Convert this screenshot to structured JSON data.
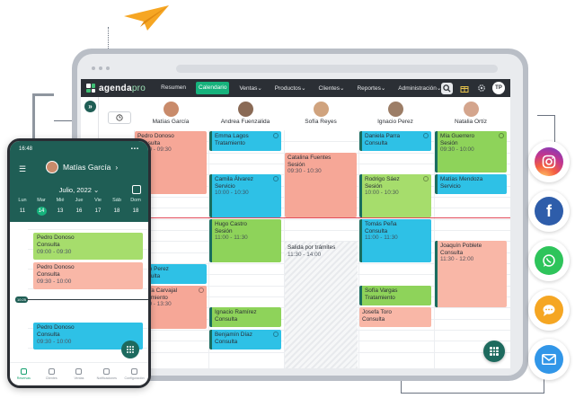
{
  "navbar": {
    "logo_text": "agenda",
    "logo_suffix": "pro",
    "menu": [
      {
        "label": "Resumen",
        "active": false
      },
      {
        "label": "Calendario",
        "active": true
      },
      {
        "label": "Ventas",
        "active": false
      },
      {
        "label": "Productos",
        "active": false
      },
      {
        "label": "Clientes",
        "active": false
      },
      {
        "label": "Reportes",
        "active": false
      },
      {
        "label": "Administración",
        "active": false
      }
    ],
    "user_initials": "TP"
  },
  "professionals": [
    {
      "name": "Matías García",
      "color": "#c98b6b"
    },
    {
      "name": "Andrea Fuenzalida",
      "color": "#8a6a55"
    },
    {
      "name": "Sofía Reyes",
      "color": "#d0a37e"
    },
    {
      "name": "Ignacio Perez",
      "color": "#9c7d66"
    },
    {
      "name": "Natalia Ortíz",
      "color": "#d4a58d"
    }
  ],
  "appointments": [
    {
      "name": "Pedro Donoso",
      "service": "Consulta",
      "time": "09:30 - 09:30"
    },
    {
      "name": "Emma Lagos",
      "service": "Tratamiento",
      "time": ""
    },
    {
      "name": "Daniela Parra",
      "service": "Consulta",
      "time": ""
    },
    {
      "name": "Mía Guerrero",
      "service": "Sesión",
      "time": "09:30 - 10:00"
    },
    {
      "name": "Catalina Fuentes",
      "service": "Sesión",
      "time": "09:30 - 10:30"
    },
    {
      "name": "Camila Álvarez",
      "service": "Servicio",
      "time": "10:00 - 10:30"
    },
    {
      "name": "Rodrigo Sáez",
      "service": "Sesión",
      "time": "10:00 - 10:30"
    },
    {
      "name": "Matías Mendoza",
      "service": "Servicio",
      "time": ""
    },
    {
      "name": "Hugo Castro",
      "service": "Sesión",
      "time": "11:00 - 11:30"
    },
    {
      "name": "Tomás Peña",
      "service": "Consulta",
      "time": "11:00 - 11:30"
    },
    {
      "name": "Salida por trámites",
      "service": "11:30 - 14:00",
      "time": ""
    },
    {
      "name": "Joaquín Poblete",
      "service": "Consulta",
      "time": "11:30 - 12:00"
    },
    {
      "name": "Pablo Perez",
      "service": "Consulta",
      "time": ""
    },
    {
      "name": "Josefa Carvajal",
      "service": "Tratamiento",
      "time": "12:30 - 13:30"
    },
    {
      "name": "Sofía Vargas",
      "service": "Tratamiento",
      "time": ""
    },
    {
      "name": "Ignacio Ramírez",
      "service": "Consulta",
      "time": ""
    },
    {
      "name": "Josefa Toro",
      "service": "Consulta",
      "time": ""
    },
    {
      "name": "Benjamín Díaz",
      "service": "Consulta",
      "time": ""
    }
  ],
  "phone": {
    "status_time": "16:48",
    "user_name": "Matías García",
    "month": "Julio, 2022",
    "days": [
      {
        "dow": "Lun",
        "num": "11",
        "selected": false
      },
      {
        "dow": "Mar",
        "num": "14",
        "selected": true
      },
      {
        "dow": "Mié",
        "num": "13",
        "selected": false
      },
      {
        "dow": "Jue",
        "num": "16",
        "selected": false
      },
      {
        "dow": "Vie",
        "num": "17",
        "selected": false
      },
      {
        "dow": "Sáb",
        "num": "18",
        "selected": false
      },
      {
        "dow": "Dom",
        "num": "18",
        "selected": false
      }
    ],
    "now_tag": "10:25",
    "appointments": [
      {
        "name": "Pedro Donoso",
        "service": "Consulta",
        "time": "09:00 - 09:30"
      },
      {
        "name": "Pedro Donoso",
        "service": "Consulta",
        "time": "09:30 - 10:00"
      },
      {
        "name": "Pedro Donoso",
        "service": "Consulta",
        "time": "09:30 - 10:00"
      }
    ],
    "tabs": [
      "Reservas",
      "Clientes",
      "Ventas",
      "Notificaciones",
      "Configuración"
    ]
  },
  "channels": [
    "instagram-icon",
    "facebook-icon",
    "whatsapp-icon",
    "sms-icon",
    "email-icon"
  ],
  "colors": {
    "brand_dark": "#1f5e55",
    "accent": "#16b27c",
    "now_line": "#e24a5a"
  }
}
